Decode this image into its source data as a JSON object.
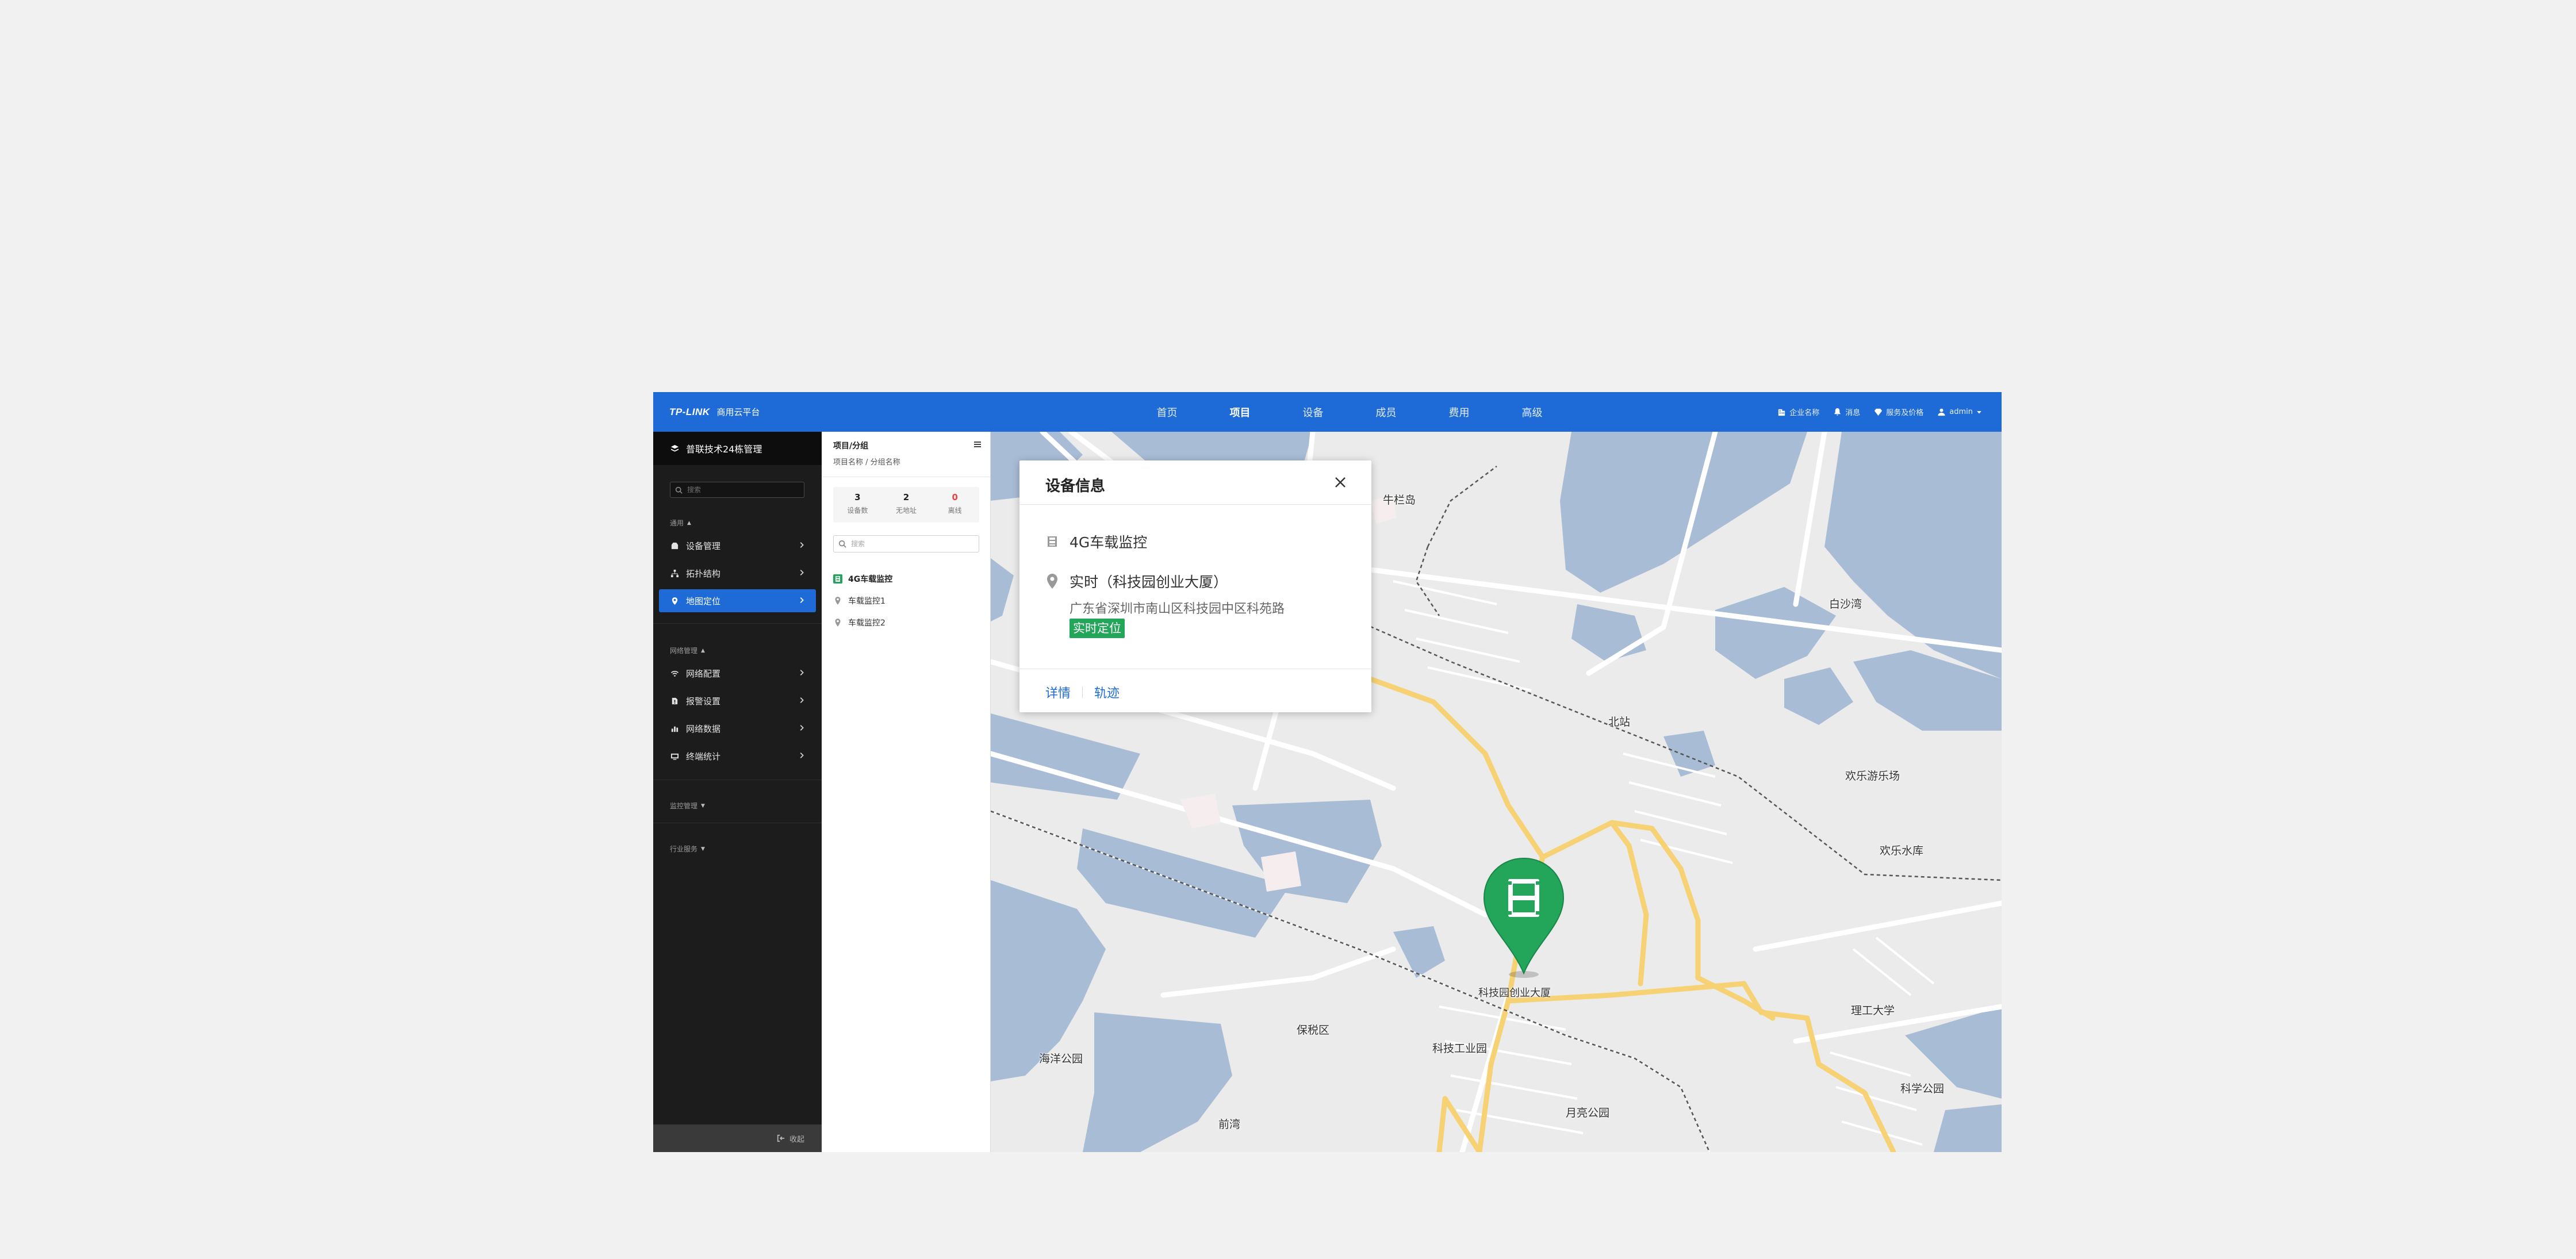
{
  "topbar": {
    "logo": "TP-LINK",
    "platform": "商用云平台",
    "nav": [
      {
        "label": "首页",
        "active": false
      },
      {
        "label": "项目",
        "active": true
      },
      {
        "label": "设备",
        "active": false
      },
      {
        "label": "成员",
        "active": false
      },
      {
        "label": "费用",
        "active": false
      },
      {
        "label": "高级",
        "active": false
      }
    ],
    "right": {
      "enterprise": "企业名称",
      "messages": "消息",
      "service": "服务及价格",
      "user": "admin"
    }
  },
  "sidebar": {
    "org": "普联技术24栋管理",
    "search_placeholder": "搜索",
    "groups": {
      "general": "通用",
      "network": "网络管理",
      "monitor": "监控管理",
      "industry": "行业服务"
    },
    "general_items": [
      {
        "label": "设备管理",
        "icon": "device-icon"
      },
      {
        "label": "拓扑结构",
        "icon": "topology-icon"
      },
      {
        "label": "地图定位",
        "icon": "location-icon",
        "active": true
      }
    ],
    "network_items": [
      {
        "label": "网络配置",
        "icon": "wifi-icon"
      },
      {
        "label": "报警设置",
        "icon": "alarm-icon"
      },
      {
        "label": "网络数据",
        "icon": "bar-chart-icon"
      },
      {
        "label": "终端统计",
        "icon": "monitor-icon"
      }
    ],
    "collapse": "收起"
  },
  "project": {
    "header": "项目/分组",
    "breadcrumb": "项目名称 / 分组名称",
    "stats": [
      {
        "value": "3",
        "label": "设备数"
      },
      {
        "value": "2",
        "label": "无地址"
      },
      {
        "value": "0",
        "label": "离线",
        "color": "#e94545"
      }
    ],
    "search_placeholder": "搜索",
    "tree": {
      "group": "4G车载监控",
      "devices": [
        "车载监控1",
        "车载监控2"
      ]
    }
  },
  "map": {
    "labels": {
      "niulan": "牛栏岛",
      "baisha": "白沙湾",
      "beizhan": "北站",
      "huanle_park": "欢乐游乐场",
      "huanle_reservoir": "欢乐水库",
      "pin_label": "科技园创业大厦",
      "ligong": "理工大学",
      "baoshui": "保税区",
      "keji_gy": "科技工业园",
      "haiyang": "海洋公园",
      "kexue": "科学公园",
      "qianwan": "前湾",
      "yueliang": "月亮公园"
    },
    "marker_color": "#23a55a"
  },
  "popup": {
    "title": "设备信息",
    "device": "4G车载监控",
    "location": "实时（科技园创业大厦）",
    "address": "广东省深圳市南山区科技园中区科苑路",
    "badge": "实时定位",
    "actions": {
      "details": "详情",
      "track": "轨迹"
    }
  },
  "colors": {
    "brand": "#1e6bd8",
    "sidebar_bg": "#1c1c1c",
    "water": "#a9bcd6",
    "road": "#f6d274",
    "success": "#23a55a"
  }
}
